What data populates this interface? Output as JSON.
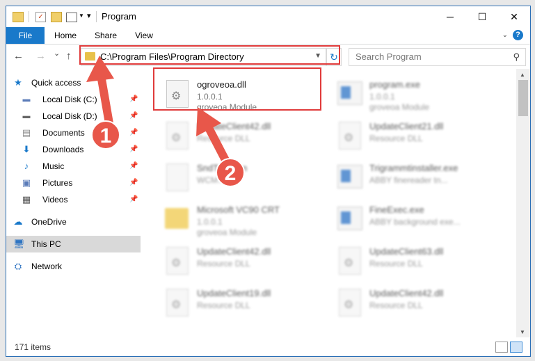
{
  "window": {
    "title": "Program",
    "controls": {
      "minimize": "─",
      "maximize": "☐",
      "close": "✕"
    }
  },
  "ribbon": {
    "tabs": [
      {
        "label": "File"
      },
      {
        "label": "Home"
      },
      {
        "label": "Share"
      },
      {
        "label": "View"
      }
    ],
    "help": "?"
  },
  "nav": {
    "back": "←",
    "forward": "→",
    "recent": "⌄",
    "up": "↑",
    "address": "C:\\Program Files\\Program Directory",
    "search_placeholder": "Search Program"
  },
  "sidebar": {
    "items": [
      {
        "label": "Quick access",
        "icon": "star-icon"
      },
      {
        "label": "Local Disk (C:)",
        "icon": "drive-icon"
      },
      {
        "label": "Local Disk (D:)",
        "icon": "drive-icon"
      },
      {
        "label": "Documents",
        "icon": "documents-icon"
      },
      {
        "label": "Downloads",
        "icon": "download-icon"
      },
      {
        "label": "Music",
        "icon": "music-icon"
      },
      {
        "label": "Pictures",
        "icon": "pictures-icon"
      },
      {
        "label": "Videos",
        "icon": "videos-icon"
      },
      {
        "label": "OneDrive",
        "icon": "cloud-icon"
      },
      {
        "label": "This PC",
        "icon": "computer-icon"
      },
      {
        "label": "Network",
        "icon": "network-icon"
      }
    ]
  },
  "files": [
    {
      "name": "ogroveoa.dll",
      "line2": "1.0.0.1",
      "line3": "groveoa Module"
    },
    {
      "name": "program.exe",
      "line2": "1.0.0.1",
      "line3": "groveoa Module"
    },
    {
      "name": "UpdateClient42.dll",
      "line2": "Resource DLL",
      "line3": ""
    },
    {
      "name": "UpdateClient21.dll",
      "line2": "Resource DLL",
      "line3": ""
    },
    {
      "name": "SndTo...acm",
      "line2": "WCM...",
      "line3": ""
    },
    {
      "name": "Trigrammtinstaller.exe",
      "line2": "ABBY finereader tn...",
      "line3": ""
    },
    {
      "name": "Microsoft VC90 CRT",
      "line2": "1.0.0.1",
      "line3": "groveoa Module"
    },
    {
      "name": "FineExec.exe",
      "line2": "ABBY background exe...",
      "line3": ""
    },
    {
      "name": "UpdateClient42.dll",
      "line2": "Resource DLL",
      "line3": ""
    },
    {
      "name": "UpdateClient63.dll",
      "line2": "Resource DLL",
      "line3": ""
    },
    {
      "name": "UpdateClient19.dll",
      "line2": "Resource DLL",
      "line3": ""
    },
    {
      "name": "UpdateClient42.dll",
      "line2": "Resource DLL",
      "line3": ""
    }
  ],
  "status": {
    "items": "171 items"
  },
  "annotations": {
    "step1": "1",
    "step2": "2"
  },
  "colors": {
    "accent": "#1979ca",
    "highlight": "#e03b3b"
  }
}
